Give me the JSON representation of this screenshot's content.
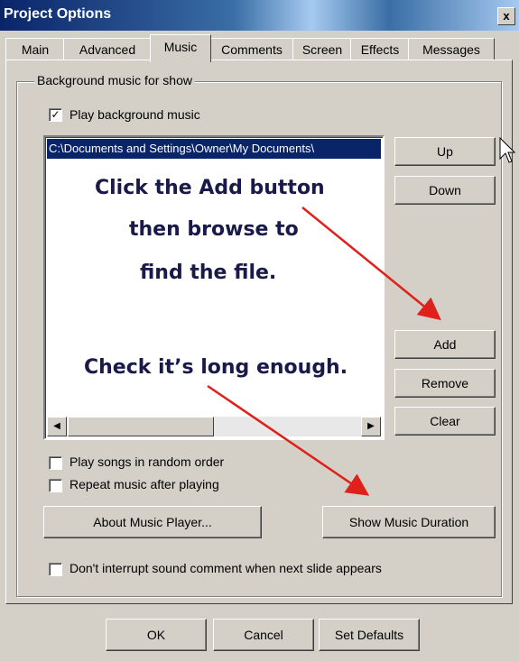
{
  "window": {
    "title": "Project Options",
    "close": "x"
  },
  "tabs": [
    "Main",
    "Advanced",
    "Music",
    "Comments",
    "Screen",
    "Effects",
    "Messages"
  ],
  "group": {
    "label": "Background music for show",
    "play_bg": {
      "label": "Play background music",
      "checked": true
    }
  },
  "list": {
    "selected_item": "C:\\Documents and Settings\\Owner\\My Documents\\"
  },
  "side_buttons": {
    "up": "Up",
    "down": "Down",
    "add": "Add",
    "remove": "Remove",
    "clear": "Clear"
  },
  "options": {
    "random": "Play songs in random order",
    "repeat": "Repeat music after playing",
    "interrupt": "Don't interrupt sound comment when next slide appears"
  },
  "actions": {
    "about": "About Music Player...",
    "duration": "Show Music Duration"
  },
  "footer": {
    "ok": "OK",
    "cancel": "Cancel",
    "defaults": "Set Defaults"
  },
  "annotations": {
    "line1": "Click the Add button",
    "line2": "then browse to",
    "line3": "find the file.",
    "line4": "Check it’s long enough."
  },
  "colors": {
    "selection": "#0a246a",
    "arrow": "#e0201a",
    "annotation_text": "#1a1a4a"
  }
}
